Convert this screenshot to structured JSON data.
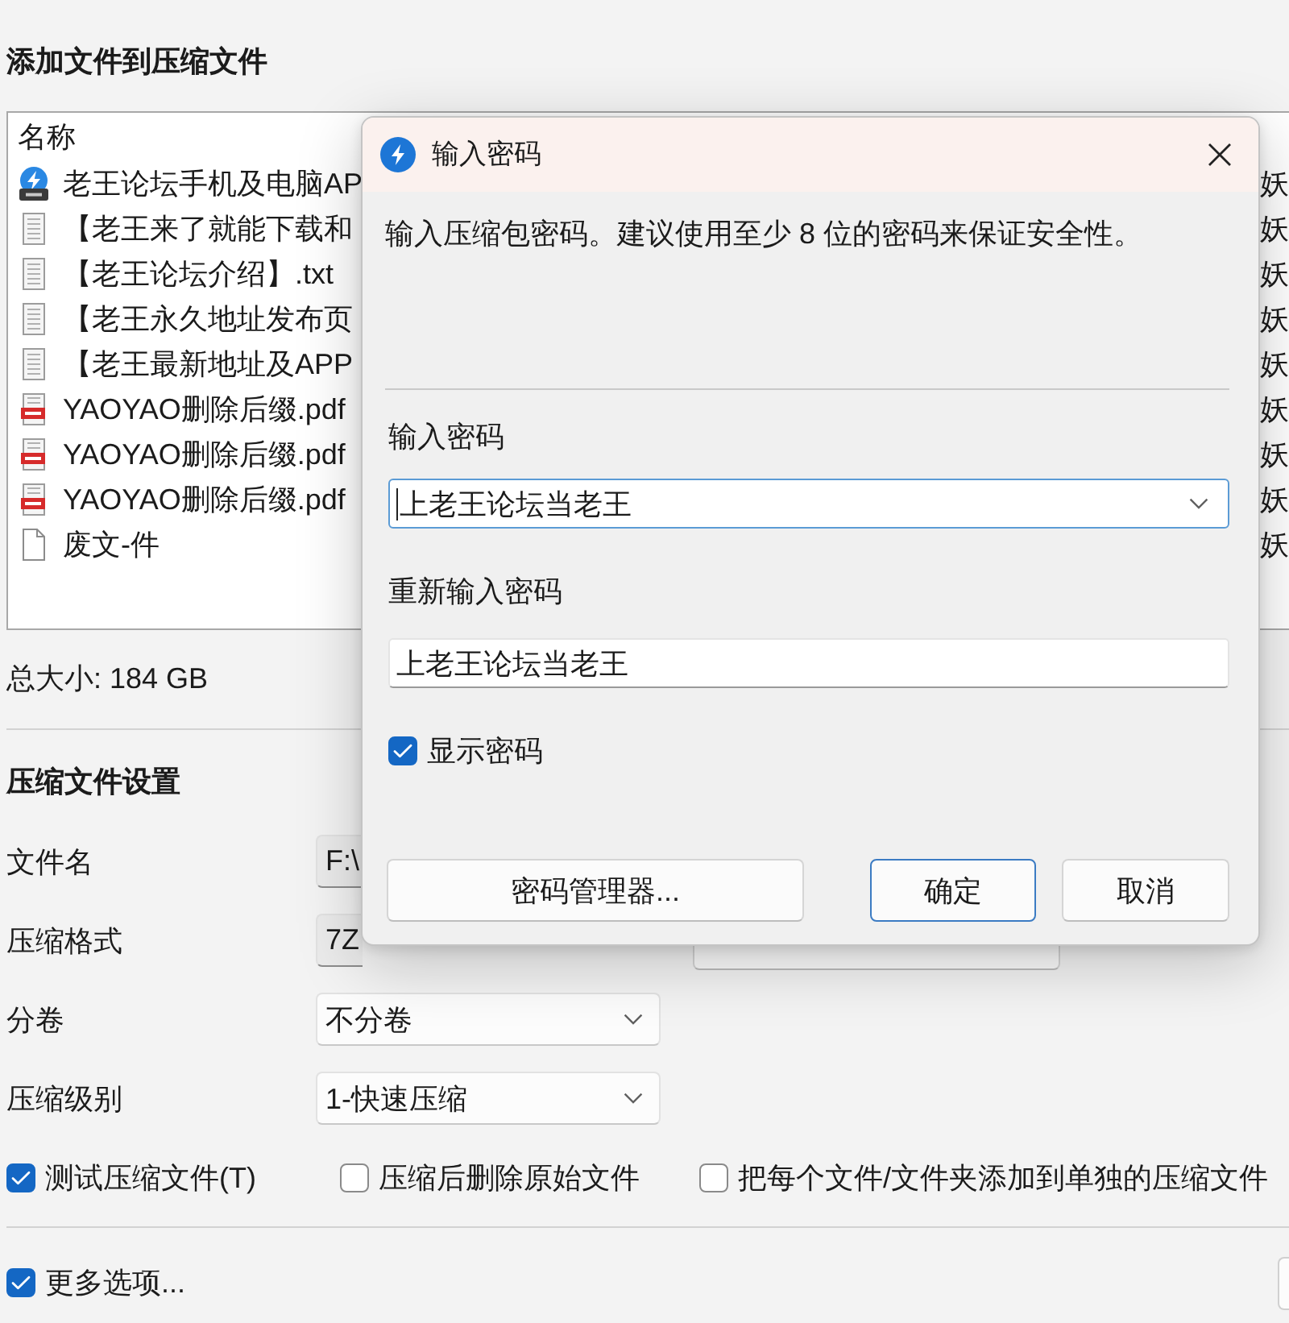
{
  "window": {
    "title": "添加文件到压缩文件"
  },
  "file_list": {
    "columns": [
      {
        "label": "名称"
      }
    ],
    "rows": [
      {
        "kind": "zip",
        "name": "老王论坛手机及电脑AP",
        "column_2": "妖"
      },
      {
        "kind": "text",
        "name": "【老王来了就能下载和",
        "column_2": "妖"
      },
      {
        "kind": "text",
        "name": "【老王论坛介绍】.txt",
        "column_2": "妖"
      },
      {
        "kind": "text",
        "name": "【老王永久地址发布页",
        "column_2": "妖"
      },
      {
        "kind": "text",
        "name": "【老王最新地址及APP",
        "column_2": "妖"
      },
      {
        "kind": "pdf",
        "name": "YAOYAO删除后缀.pdf",
        "column_2": "妖"
      },
      {
        "kind": "pdf",
        "name": "YAOYAO删除后缀.pdf",
        "column_2": "妖"
      },
      {
        "kind": "pdf",
        "name": "YAOYAO删除后缀.pdf",
        "column_2": "妖"
      },
      {
        "kind": "blank",
        "name": "废文-件",
        "column_2": "妖"
      }
    ]
  },
  "total_size": "总大小: 184 GB",
  "settings": {
    "title": "压缩文件设置",
    "fields": [
      {
        "label": "文件名",
        "kind": "input",
        "value": "F:\\"
      },
      {
        "label": "压缩格式",
        "kind": "input",
        "value": "7Z"
      },
      {
        "label": "分卷",
        "kind": "dropdown",
        "value": "不分卷"
      },
      {
        "label": "压缩级别",
        "kind": "dropdown",
        "value": "1-快速压缩"
      }
    ],
    "options": [
      {
        "label": "测试压缩文件(T)",
        "checked": true
      },
      {
        "label": "压缩后删除原始文件",
        "checked": false
      },
      {
        "label": "把每个文件/文件夹添加到单独的压缩文件",
        "checked": false
      }
    ]
  },
  "more_options": {
    "label": "更多选项...",
    "checked": true
  },
  "password_dialog": {
    "title": "输入密码",
    "description": "输入压缩包密码。建议使用至少 8 位的密码来保证安全性。",
    "password_label": "输入密码",
    "password": {
      "value": "上老王论坛当老王",
      "focused": true
    },
    "confirm_label": "重新输入密码",
    "confirm": {
      "value": "上老王论坛当老王",
      "focused": false
    },
    "show_password": {
      "label": "显示密码",
      "checked": true
    },
    "buttons": [
      {
        "label": "密码管理器...",
        "default": false
      },
      {
        "label": "确定",
        "default": true
      },
      {
        "label": "取消",
        "default": false
      }
    ]
  }
}
